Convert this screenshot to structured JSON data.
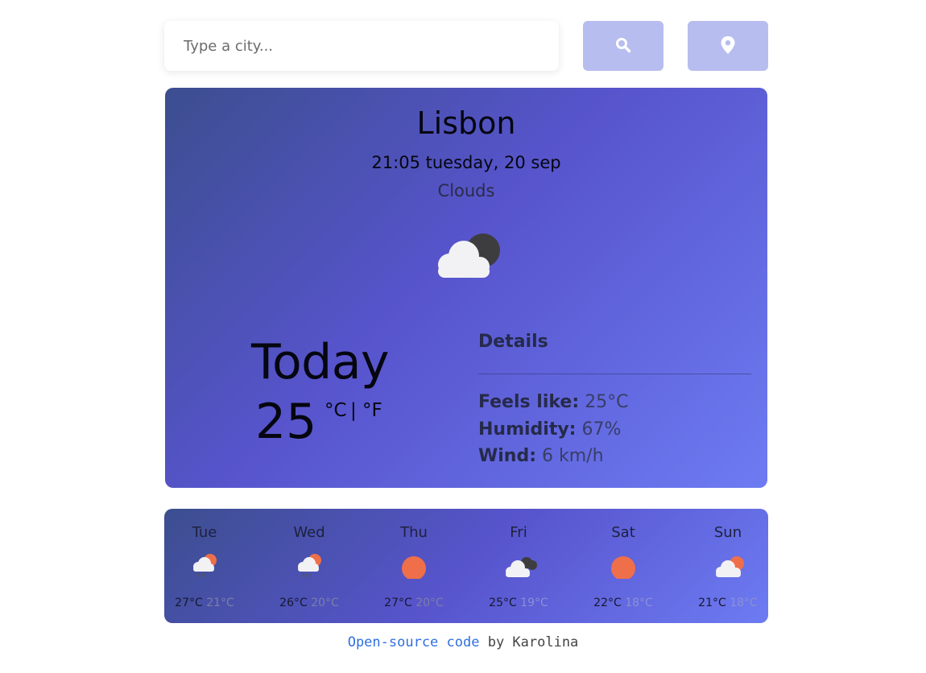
{
  "search": {
    "placeholder": "Type a city..."
  },
  "buttons": {
    "search_icon": "search-icon",
    "location_icon": "map-pin-icon"
  },
  "current": {
    "city": "Lisbon",
    "datetime": "21:05 tuesday, 20 sep",
    "condition": "Clouds",
    "icon": "cloud-moon-icon",
    "today_label": "Today",
    "temperature": "25",
    "unit_c": "°C",
    "unit_sep": "|",
    "unit_f": "°F"
  },
  "details": {
    "title": "Details",
    "feels_like_label": "Feels like:",
    "feels_like_value": "25°C",
    "humidity_label": "Humidity:",
    "humidity_value": "67%",
    "wind_label": "Wind:",
    "wind_value": "6 km/h"
  },
  "forecast": [
    {
      "day": "Tue",
      "icon": "rain-sun-icon",
      "max": "27°C",
      "min": "21°C"
    },
    {
      "day": "Wed",
      "icon": "rain-sun-icon",
      "max": "26°C",
      "min": "20°C"
    },
    {
      "day": "Thu",
      "icon": "sun-icon",
      "max": "27°C",
      "min": "20°C"
    },
    {
      "day": "Fri",
      "icon": "cloudy-icon",
      "max": "25°C",
      "min": "19°C"
    },
    {
      "day": "Sat",
      "icon": "sun-icon",
      "max": "22°C",
      "min": "18°C"
    },
    {
      "day": "Sun",
      "icon": "cloud-sun-icon",
      "max": "21°C",
      "min": "18°C"
    }
  ],
  "footer": {
    "link_text": "Open-source code",
    "suffix": " by Karolina"
  },
  "colors": {
    "accent_button": "#b7bdef",
    "sun": "#ef6f4a",
    "link": "#2f6fe0"
  }
}
